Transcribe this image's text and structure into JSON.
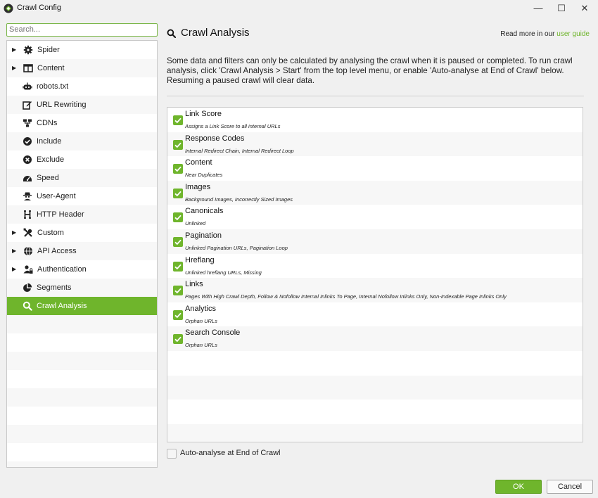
{
  "window": {
    "title": "Crawl Config",
    "minimize_glyph": "—",
    "maximize_glyph": "☐",
    "close_glyph": "✕"
  },
  "sidebar": {
    "search_placeholder": "Search...",
    "items": [
      {
        "label": "Spider",
        "icon": "gear-icon",
        "expandable": true
      },
      {
        "label": "Content",
        "icon": "content-icon",
        "expandable": true
      },
      {
        "label": "robots.txt",
        "icon": "robot-icon",
        "expandable": false
      },
      {
        "label": "URL Rewriting",
        "icon": "edit-icon",
        "expandable": false
      },
      {
        "label": "CDNs",
        "icon": "sitemap-icon",
        "expandable": false
      },
      {
        "label": "Include",
        "icon": "check-circle-icon",
        "expandable": false
      },
      {
        "label": "Exclude",
        "icon": "times-circle-icon",
        "expandable": false
      },
      {
        "label": "Speed",
        "icon": "speedometer-icon",
        "expandable": false
      },
      {
        "label": "User-Agent",
        "icon": "user-secret-icon",
        "expandable": false
      },
      {
        "label": "HTTP Header",
        "icon": "header-icon",
        "expandable": false
      },
      {
        "label": "Custom",
        "icon": "tools-icon",
        "expandable": true
      },
      {
        "label": "API Access",
        "icon": "globe-icon",
        "expandable": true
      },
      {
        "label": "Authentication",
        "icon": "user-lock-icon",
        "expandable": true
      },
      {
        "label": "Segments",
        "icon": "pie-chart-icon",
        "expandable": false
      },
      {
        "label": "Crawl Analysis",
        "icon": "search-icon",
        "expandable": false,
        "selected": true
      }
    ]
  },
  "main": {
    "title": "Crawl Analysis",
    "read_more_prefix": "Read more in our ",
    "read_more_link": "user guide",
    "description": "Some data and filters can only be calculated by analysing the crawl when it is paused or completed. To run crawl analysis, click 'Crawl Analysis > Start' from the top level menu, or enable 'Auto-analyse at End of Crawl' below. Resuming a paused crawl will clear data.",
    "options": [
      {
        "title": "Link Score",
        "subtitle": "Assigns a Link Score to all internal URLs",
        "checked": true
      },
      {
        "title": "Response Codes",
        "subtitle": "Internal Redirect Chain, Internal Redirect Loop",
        "checked": true
      },
      {
        "title": "Content",
        "subtitle": "Near Duplicates",
        "checked": true
      },
      {
        "title": "Images",
        "subtitle": "Background Images, Incorrectly Sized Images",
        "checked": true
      },
      {
        "title": "Canonicals",
        "subtitle": "Unlinked",
        "checked": true
      },
      {
        "title": "Pagination",
        "subtitle": "Unlinked Pagination URLs, Pagination Loop",
        "checked": true
      },
      {
        "title": "Hreflang",
        "subtitle": "Unlinked hreflang URLs, Missing",
        "checked": true
      },
      {
        "title": "Links",
        "subtitle": "Pages With High Crawl Depth, Follow & Nofollow Internal Inlinks To Page, Internal Nofollow Inlinks Only, Non-Indexable Page Inlinks Only",
        "checked": true
      },
      {
        "title": "Analytics",
        "subtitle": "Orphan URLs",
        "checked": true
      },
      {
        "title": "Search Console",
        "subtitle": "Orphan URLs",
        "checked": true
      }
    ],
    "auto_analyse_label": "Auto-analyse at End of Crawl",
    "auto_analyse_checked": false
  },
  "footer": {
    "ok_label": "OK",
    "cancel_label": "Cancel"
  },
  "colors": {
    "accent": "#6fb52c",
    "selected_row": "#6fb52c"
  }
}
